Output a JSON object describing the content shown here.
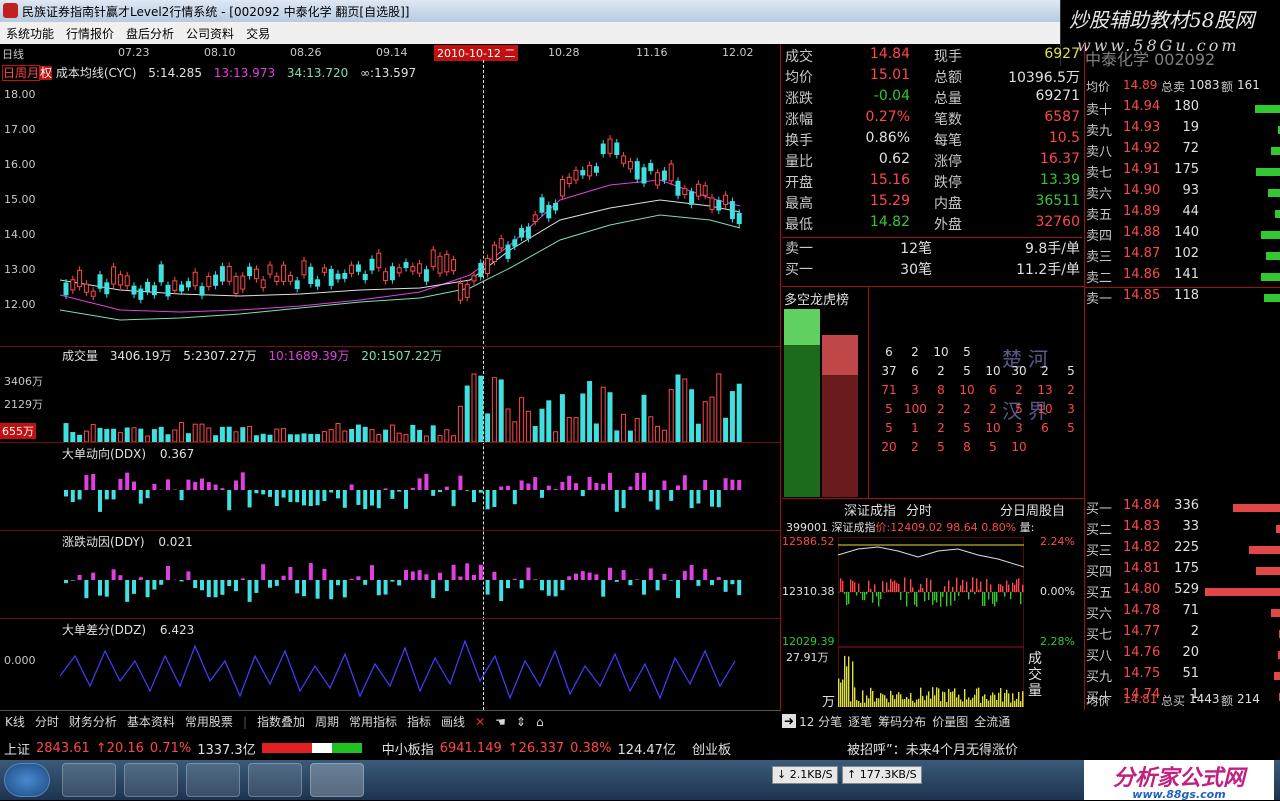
{
  "window": {
    "title": "民族证券指南针赢才Level2行情系统 - [002092 中泰化学 翻页[自选股]]"
  },
  "watermark": {
    "line1": "炒股辅助教材58股网",
    "line2": "www.58Gu.com"
  },
  "menu": [
    "系统功能",
    "行情报价",
    "盘后分析",
    "公司资料",
    "交易"
  ],
  "chart": {
    "period": "日线",
    "period_tabs": "日周月",
    "right_tag": "权",
    "indicator_name": "成本均线(CYC)",
    "ma5": "5:14.285",
    "ma13": "13:13.973",
    "ma34": "34:13.720",
    "ma_inf": "∞:13.597",
    "dates": [
      "07.23",
      "08.10",
      "08.26",
      "09.14",
      "10.28",
      "11.16",
      "12.02"
    ],
    "cursor_date": "2010-10-12 二",
    "price_ticks": [
      "18.00",
      "17.00",
      "16.00",
      "15.00",
      "14.00",
      "13.00",
      "12.00"
    ],
    "vol_title": "成交量",
    "vol_value": "3406.19万",
    "vol5": "5:2307.27万",
    "vol10": "10:1689.39万",
    "vol20": "20:1507.22万",
    "vol_ticks": [
      "3406万",
      "2129万",
      "655万"
    ],
    "ddx_title": "大单动向(DDX)",
    "ddx_value": "0.367",
    "ddy_title": "涨跌动因(DDY)",
    "ddy_value": "0.021",
    "ddz_title": "大单差分(DDZ)",
    "ddz_value": "6.423",
    "ddz_zero": "0.000"
  },
  "quote": {
    "stock": "中泰化学",
    "code": "002092",
    "rows": [
      {
        "l": "成交",
        "v": "14.84",
        "l2": "现手",
        "v2": "6927"
      },
      {
        "l": "均价",
        "v": "15.01",
        "l2": "总额",
        "v2": "10396.5万"
      },
      {
        "l": "涨跌",
        "v": "-0.04",
        "l2": "总量",
        "v2": "69271"
      },
      {
        "l": "涨幅",
        "v": "0.27%",
        "l2": "笔数",
        "v2": "6587"
      },
      {
        "l": "换手",
        "v": "0.86%",
        "l2": "每笔",
        "v2": "10.5"
      },
      {
        "l": "量比",
        "v": "0.62",
        "l2": "涨停",
        "v2": "16.37"
      },
      {
        "l": "开盘",
        "v": "15.16",
        "l2": "跌停",
        "v2": "13.39"
      },
      {
        "l": "最高",
        "v": "15.29",
        "l2": "内盘",
        "v2": "36511"
      },
      {
        "l": "最低",
        "v": "14.82",
        "l2": "外盘",
        "v2": "32760"
      }
    ],
    "sell1": {
      "l": "卖一",
      "n": "12笔",
      "v": "9.8手/单"
    },
    "buy1": {
      "l": "买一",
      "n": "30笔",
      "v": "11.2手/单"
    }
  },
  "orderbook": {
    "avg_label": "均价",
    "avg_price": "14.89",
    "total_sell_label": "总卖",
    "total_sell": "1083",
    "amount_label": "额",
    "amount_sell": "161",
    "asks": [
      {
        "n": "卖十",
        "p": "14.94",
        "q": "180"
      },
      {
        "n": "卖九",
        "p": "14.93",
        "q": "19"
      },
      {
        "n": "卖八",
        "p": "14.92",
        "q": "72"
      },
      {
        "n": "卖七",
        "p": "14.91",
        "q": "175"
      },
      {
        "n": "卖六",
        "p": "14.90",
        "q": "93"
      },
      {
        "n": "卖五",
        "p": "14.89",
        "q": "44"
      },
      {
        "n": "卖四",
        "p": "14.88",
        "q": "140"
      },
      {
        "n": "卖三",
        "p": "14.87",
        "q": "102"
      },
      {
        "n": "卖二",
        "p": "14.86",
        "q": "141"
      },
      {
        "n": "卖一",
        "p": "14.85",
        "q": "118"
      }
    ],
    "bids": [
      {
        "n": "买一",
        "p": "14.84",
        "q": "336"
      },
      {
        "n": "买二",
        "p": "14.83",
        "q": "33"
      },
      {
        "n": "买三",
        "p": "14.82",
        "q": "225"
      },
      {
        "n": "买四",
        "p": "14.81",
        "q": "175"
      },
      {
        "n": "买五",
        "p": "14.80",
        "q": "529"
      },
      {
        "n": "买六",
        "p": "14.78",
        "q": "71"
      },
      {
        "n": "买七",
        "p": "14.77",
        "q": "2"
      },
      {
        "n": "买八",
        "p": "14.76",
        "q": "20"
      },
      {
        "n": "买九",
        "p": "14.75",
        "q": "51"
      },
      {
        "n": "买十",
        "p": "14.74",
        "q": "1"
      }
    ],
    "avg_label2": "均价",
    "avg_price2": "14.81",
    "total_buy_label": "总买",
    "total_buy": "1443",
    "amount_label2": "额",
    "amount_buy": "214"
  },
  "dk": {
    "title": "多空龙虎榜",
    "wm1": "楚河",
    "wm2": "汉界",
    "rows": [
      [
        "6",
        "2",
        "10",
        "5",
        "",
        "",
        "",
        ""
      ],
      [
        "37",
        "6",
        "2",
        "5",
        "10",
        "30",
        "2",
        "5"
      ],
      [
        "71",
        "3",
        "8",
        "10",
        "6",
        "2",
        "13",
        "2"
      ],
      [
        "5",
        "100",
        "2",
        "2",
        "2",
        "5",
        "10",
        "3"
      ],
      [
        "5",
        "1",
        "2",
        "5",
        "10",
        "3",
        "6",
        "5"
      ],
      [
        "20",
        "2",
        "5",
        "8",
        "5",
        "10",
        "",
        ""
      ]
    ]
  },
  "mini": {
    "tab_title": "深证成指",
    "tab_fs": "分时",
    "tab_right": "分日周股自",
    "code": "399001",
    "name": "深证成指",
    "price_label": "价:12409.02",
    "pct": "98.64",
    "pct2": "0.80%",
    "vol_lbl": "量:",
    "y1": "12586.52",
    "y2": "12310.38",
    "y3": "12029.39",
    "p1": "2.24%",
    "p2": "0.00%",
    "p3": "2.28%",
    "vol_y": "27.91万",
    "vol_unit": "万",
    "vol_label": "成交量"
  },
  "toolbar": [
    "K线",
    "分时",
    "财务分析",
    "基本资料",
    "常用股票",
    "指数叠加",
    "周期",
    "常用指标",
    "指标",
    "画线"
  ],
  "toolbar2": [
    "12 分笔",
    "逐笔",
    "筹码分布",
    "价量图",
    "全流通"
  ],
  "ticker": {
    "sh_label": "上证",
    "sh_val": "2843.61",
    "sh_chg": "↑20.16",
    "sh_pct": "0.71%",
    "sh_amt": "1337.3亿",
    "zx_label": "中小板指",
    "zx_val": "6941.149",
    "zx_chg": "↑26.337",
    "zx_pct": "0.38%",
    "zx_amt": "124.47亿",
    "cy_label": "创业板",
    "news": "被招呼”：未来4个月无得涨价"
  },
  "net": {
    "down": "2.1KB/S",
    "up": "177.3KB/S"
  },
  "wm_bottom": "分析家公式网",
  "wm_bottom2": "www.88gs.com"
}
